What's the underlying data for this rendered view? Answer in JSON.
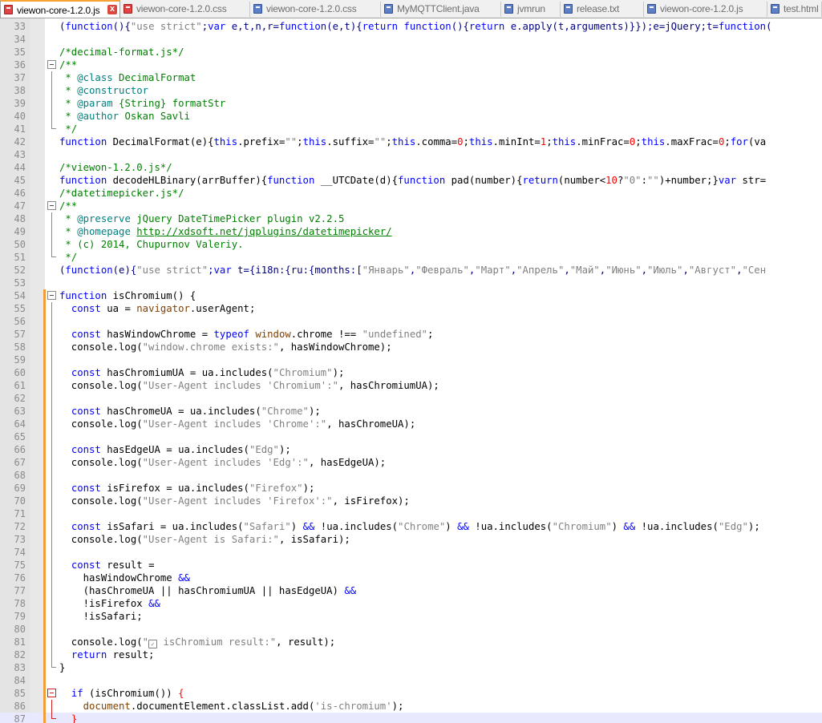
{
  "tabs": [
    {
      "label": "viewon-core-1.2.0.js",
      "active": true,
      "icon": "file-saved-red-icon"
    },
    {
      "label": "viewon-core-1.2.0.css",
      "active": false,
      "icon": "file-saved-red-icon"
    },
    {
      "label": "viewon-core-1.2.0.css",
      "active": false,
      "icon": "file-blue-icon"
    },
    {
      "label": "MyMQTTClient.java",
      "active": false,
      "icon": "file-blue-icon"
    },
    {
      "label": "jvmrun",
      "active": false,
      "icon": "file-blue-icon"
    },
    {
      "label": "release.txt",
      "active": false,
      "icon": "file-blue-icon"
    },
    {
      "label": "viewon-core-1.2.0.js",
      "active": false,
      "icon": "file-blue-icon"
    },
    {
      "label": "test.html",
      "active": false,
      "icon": "file-blue-icon"
    }
  ],
  "close_glyph": "x",
  "lines": [
    {
      "n": "33",
      "t": [
        [
          "o",
          "("
        ],
        [
          "k",
          "function"
        ],
        [
          "o",
          "(){"
        ],
        [
          "s",
          "\"use strict\""
        ],
        [
          "o",
          ";"
        ],
        [
          "k",
          "var"
        ],
        [
          "o",
          " e,t,n,r="
        ],
        [
          "k",
          "function"
        ],
        [
          "o",
          "(e,t){"
        ],
        [
          "k",
          "return"
        ],
        [
          "o",
          " "
        ],
        [
          "k",
          "function"
        ],
        [
          "o",
          "(){"
        ],
        [
          "k",
          "return"
        ],
        [
          "o",
          " e.apply(t,arguments)}});e=jQuery;t="
        ],
        [
          "k",
          "function"
        ],
        [
          "o",
          "("
        ]
      ]
    },
    {
      "n": "34",
      "t": []
    },
    {
      "n": "35",
      "t": [
        [
          "c",
          "/*decimal-format.js*/"
        ]
      ]
    },
    {
      "n": "36",
      "t": [
        [
          "c",
          "/**"
        ]
      ]
    },
    {
      "n": "37",
      "t": [
        [
          "c",
          " * "
        ],
        [
          "d",
          "@class"
        ],
        [
          "c",
          " DecimalFormat"
        ]
      ]
    },
    {
      "n": "38",
      "t": [
        [
          "c",
          " * "
        ],
        [
          "d",
          "@constructor"
        ]
      ]
    },
    {
      "n": "39",
      "t": [
        [
          "c",
          " * "
        ],
        [
          "d",
          "@param"
        ],
        [
          "c",
          " {String} formatStr"
        ]
      ]
    },
    {
      "n": "40",
      "t": [
        [
          "c",
          " * "
        ],
        [
          "d",
          "@author"
        ],
        [
          "c",
          " Oskan Savli"
        ]
      ]
    },
    {
      "n": "41",
      "t": [
        [
          "c",
          " */"
        ]
      ]
    },
    {
      "n": "42",
      "t": [
        [
          "k",
          "function"
        ],
        [
          "",
          " DecimalFormat(e){"
        ],
        [
          "k",
          "this"
        ],
        [
          "",
          ".prefix="
        ],
        [
          "s",
          "\"\""
        ],
        [
          "",
          ";"
        ],
        [
          "k",
          "this"
        ],
        [
          "",
          ".suffix="
        ],
        [
          "s",
          "\"\""
        ],
        [
          "",
          ";"
        ],
        [
          "k",
          "this"
        ],
        [
          "",
          ".comma="
        ],
        [
          "n",
          "0"
        ],
        [
          "",
          ";"
        ],
        [
          "k",
          "this"
        ],
        [
          "",
          ".minInt="
        ],
        [
          "n",
          "1"
        ],
        [
          "",
          ";"
        ],
        [
          "k",
          "this"
        ],
        [
          "",
          ".minFrac="
        ],
        [
          "n",
          "0"
        ],
        [
          "",
          ";"
        ],
        [
          "k",
          "this"
        ],
        [
          "",
          ".maxFrac="
        ],
        [
          "n",
          "0"
        ],
        [
          "",
          ";"
        ],
        [
          "k",
          "for"
        ],
        [
          "",
          "(va"
        ]
      ]
    },
    {
      "n": "43",
      "t": []
    },
    {
      "n": "44",
      "t": [
        [
          "c",
          "/*viewon-1.2.0.js*/"
        ]
      ]
    },
    {
      "n": "45",
      "t": [
        [
          "k",
          "function"
        ],
        [
          "",
          " decodeHLBinary(arrBuffer){"
        ],
        [
          "k",
          "function"
        ],
        [
          "",
          " __UTCDate(d){"
        ],
        [
          "k",
          "function"
        ],
        [
          "",
          " pad(number){"
        ],
        [
          "k",
          "return"
        ],
        [
          "",
          "(number<"
        ],
        [
          "n",
          "10"
        ],
        [
          "",
          "?"
        ],
        [
          "s",
          "\"0\""
        ],
        [
          "",
          ":"
        ],
        [
          "s",
          "\"\""
        ],
        [
          "",
          ")+number;}"
        ],
        [
          "k",
          "var"
        ],
        [
          "",
          " str="
        ]
      ]
    },
    {
      "n": "46",
      "t": [
        [
          "c",
          "/*datetimepicker.js*/"
        ]
      ]
    },
    {
      "n": "47",
      "t": [
        [
          "c",
          "/**"
        ]
      ]
    },
    {
      "n": "48",
      "t": [
        [
          "c",
          " * "
        ],
        [
          "d",
          "@preserve"
        ],
        [
          "c",
          " jQuery DateTimePicker plugin v2.2.5"
        ]
      ]
    },
    {
      "n": "49",
      "t": [
        [
          "c",
          " * "
        ],
        [
          "d",
          "@homepage"
        ],
        [
          "c",
          " "
        ],
        [
          "u",
          "http://xdsoft.net/jqplugins/datetimepicker/"
        ]
      ]
    },
    {
      "n": "50",
      "t": [
        [
          "c",
          " * (c) 2014, Chupurnov Valeriy."
        ]
      ]
    },
    {
      "n": "51",
      "t": [
        [
          "c",
          " */"
        ]
      ]
    },
    {
      "n": "52",
      "t": [
        [
          "o",
          "("
        ],
        [
          "k",
          "function"
        ],
        [
          "o",
          "(e){"
        ],
        [
          "s",
          "\"use strict\""
        ],
        [
          "o",
          ";"
        ],
        [
          "k",
          "var"
        ],
        [
          "o",
          " t={i18n:{ru:{months:["
        ],
        [
          "s",
          "\"Январь\""
        ],
        [
          "o",
          ","
        ],
        [
          "s",
          "\"Февраль\""
        ],
        [
          "o",
          ","
        ],
        [
          "s",
          "\"Март\""
        ],
        [
          "o",
          ","
        ],
        [
          "s",
          "\"Апрель\""
        ],
        [
          "o",
          ","
        ],
        [
          "s",
          "\"Май\""
        ],
        [
          "o",
          ","
        ],
        [
          "s",
          "\"Июнь\""
        ],
        [
          "o",
          ","
        ],
        [
          "s",
          "\"Июль\""
        ],
        [
          "o",
          ","
        ],
        [
          "s",
          "\"Август\""
        ],
        [
          "o",
          ","
        ],
        [
          "s",
          "\"Сен"
        ]
      ]
    },
    {
      "n": "53",
      "t": []
    },
    {
      "n": "54",
      "t": [
        [
          "k",
          "function"
        ],
        [
          "",
          " isChromium() {"
        ]
      ]
    },
    {
      "n": "55",
      "t": [
        [
          "",
          "  "
        ],
        [
          "k",
          "const"
        ],
        [
          "",
          " ua = "
        ],
        [
          "g",
          "navigator"
        ],
        [
          "",
          ".userAgent;"
        ]
      ]
    },
    {
      "n": "56",
      "t": []
    },
    {
      "n": "57",
      "t": [
        [
          "",
          "  "
        ],
        [
          "k",
          "const"
        ],
        [
          "",
          " hasWindowChrome = "
        ],
        [
          "k",
          "typeof"
        ],
        [
          "",
          " "
        ],
        [
          "g",
          "window"
        ],
        [
          "",
          ".chrome !== "
        ],
        [
          "s",
          "\"undefined\""
        ],
        [
          "",
          ";"
        ]
      ]
    },
    {
      "n": "58",
      "t": [
        [
          "",
          "  console.log("
        ],
        [
          "s",
          "\"window.chrome exists:\""
        ],
        [
          "",
          ", hasWindowChrome);"
        ]
      ]
    },
    {
      "n": "59",
      "t": []
    },
    {
      "n": "60",
      "t": [
        [
          "",
          "  "
        ],
        [
          "k",
          "const"
        ],
        [
          "",
          " hasChromiumUA = ua.includes("
        ],
        [
          "s",
          "\"Chromium\""
        ],
        [
          "",
          ");"
        ]
      ]
    },
    {
      "n": "61",
      "t": [
        [
          "",
          "  console.log("
        ],
        [
          "s",
          "\"User-Agent includes 'Chromium':\""
        ],
        [
          "",
          ", hasChromiumUA);"
        ]
      ]
    },
    {
      "n": "62",
      "t": []
    },
    {
      "n": "63",
      "t": [
        [
          "",
          "  "
        ],
        [
          "k",
          "const"
        ],
        [
          "",
          " hasChromeUA = ua.includes("
        ],
        [
          "s",
          "\"Chrome\""
        ],
        [
          "",
          ");"
        ]
      ]
    },
    {
      "n": "64",
      "t": [
        [
          "",
          "  console.log("
        ],
        [
          "s",
          "\"User-Agent includes 'Chrome':\""
        ],
        [
          "",
          ", hasChromeUA);"
        ]
      ]
    },
    {
      "n": "65",
      "t": []
    },
    {
      "n": "66",
      "t": [
        [
          "",
          "  "
        ],
        [
          "k",
          "const"
        ],
        [
          "",
          " hasEdgeUA = ua.includes("
        ],
        [
          "s",
          "\"Edg\""
        ],
        [
          "",
          ");"
        ]
      ]
    },
    {
      "n": "67",
      "t": [
        [
          "",
          "  console.log("
        ],
        [
          "s",
          "\"User-Agent includes 'Edg':\""
        ],
        [
          "",
          ", hasEdgeUA);"
        ]
      ]
    },
    {
      "n": "68",
      "t": []
    },
    {
      "n": "69",
      "t": [
        [
          "",
          "  "
        ],
        [
          "k",
          "const"
        ],
        [
          "",
          " isFirefox = ua.includes("
        ],
        [
          "s",
          "\"Firefox\""
        ],
        [
          "",
          ");"
        ]
      ]
    },
    {
      "n": "70",
      "t": [
        [
          "",
          "  console.log("
        ],
        [
          "s",
          "\"User-Agent includes 'Firefox':\""
        ],
        [
          "",
          ", isFirefox);"
        ]
      ]
    },
    {
      "n": "71",
      "t": []
    },
    {
      "n": "72",
      "t": [
        [
          "",
          "  "
        ],
        [
          "k",
          "const"
        ],
        [
          "",
          " isSafari = ua.includes("
        ],
        [
          "s",
          "\"Safari\""
        ],
        [
          "",
          ") "
        ],
        [
          "k",
          "&&"
        ],
        [
          "",
          " !ua.includes("
        ],
        [
          "s",
          "\"Chrome\""
        ],
        [
          "",
          ") "
        ],
        [
          "k",
          "&&"
        ],
        [
          "",
          " !ua.includes("
        ],
        [
          "s",
          "\"Chromium\""
        ],
        [
          "",
          ") "
        ],
        [
          "k",
          "&&"
        ],
        [
          "",
          " !ua.includes("
        ],
        [
          "s",
          "\"Edg\""
        ],
        [
          "",
          ");"
        ]
      ]
    },
    {
      "n": "73",
      "t": [
        [
          "",
          "  console.log("
        ],
        [
          "s",
          "\"User-Agent is Safari:\""
        ],
        [
          "",
          ", isSafari);"
        ]
      ]
    },
    {
      "n": "74",
      "t": []
    },
    {
      "n": "75",
      "t": [
        [
          "",
          "  "
        ],
        [
          "k",
          "const"
        ],
        [
          "",
          " result ="
        ]
      ]
    },
    {
      "n": "76",
      "t": [
        [
          "",
          "    hasWindowChrome "
        ],
        [
          "k",
          "&&"
        ]
      ]
    },
    {
      "n": "77",
      "t": [
        [
          "",
          "    (hasChromeUA || hasChromiumUA || hasEdgeUA) "
        ],
        [
          "k",
          "&&"
        ]
      ]
    },
    {
      "n": "78",
      "t": [
        [
          "",
          "    !isFirefox "
        ],
        [
          "k",
          "&&"
        ]
      ]
    },
    {
      "n": "79",
      "t": [
        [
          "",
          "    !isSafari;"
        ]
      ]
    },
    {
      "n": "80",
      "t": []
    },
    {
      "n": "81",
      "t": [
        [
          "",
          "  console.log("
        ],
        [
          "s",
          "\""
        ],
        [
          "chk",
          "✓"
        ],
        [
          "s",
          " isChromium result:\""
        ],
        [
          "",
          ", result);"
        ]
      ]
    },
    {
      "n": "82",
      "t": [
        [
          "",
          "  "
        ],
        [
          "k",
          "return"
        ],
        [
          "",
          " result;"
        ]
      ]
    },
    {
      "n": "83",
      "t": [
        [
          "",
          "}"
        ]
      ]
    },
    {
      "n": "84",
      "t": []
    },
    {
      "n": "85",
      "t": [
        [
          "",
          "  "
        ],
        [
          "k",
          "if"
        ],
        [
          "",
          " (isChromium()) "
        ],
        [
          "n",
          "{"
        ]
      ]
    },
    {
      "n": "86",
      "t": [
        [
          "",
          "    "
        ],
        [
          "g",
          "document"
        ],
        [
          "",
          ".documentElement.classList.add("
        ],
        [
          "s",
          "'is-chromium'"
        ],
        [
          "",
          ");"
        ]
      ]
    },
    {
      "n": "87",
      "t": [
        [
          "",
          "  "
        ],
        [
          "n",
          "}"
        ]
      ]
    }
  ]
}
